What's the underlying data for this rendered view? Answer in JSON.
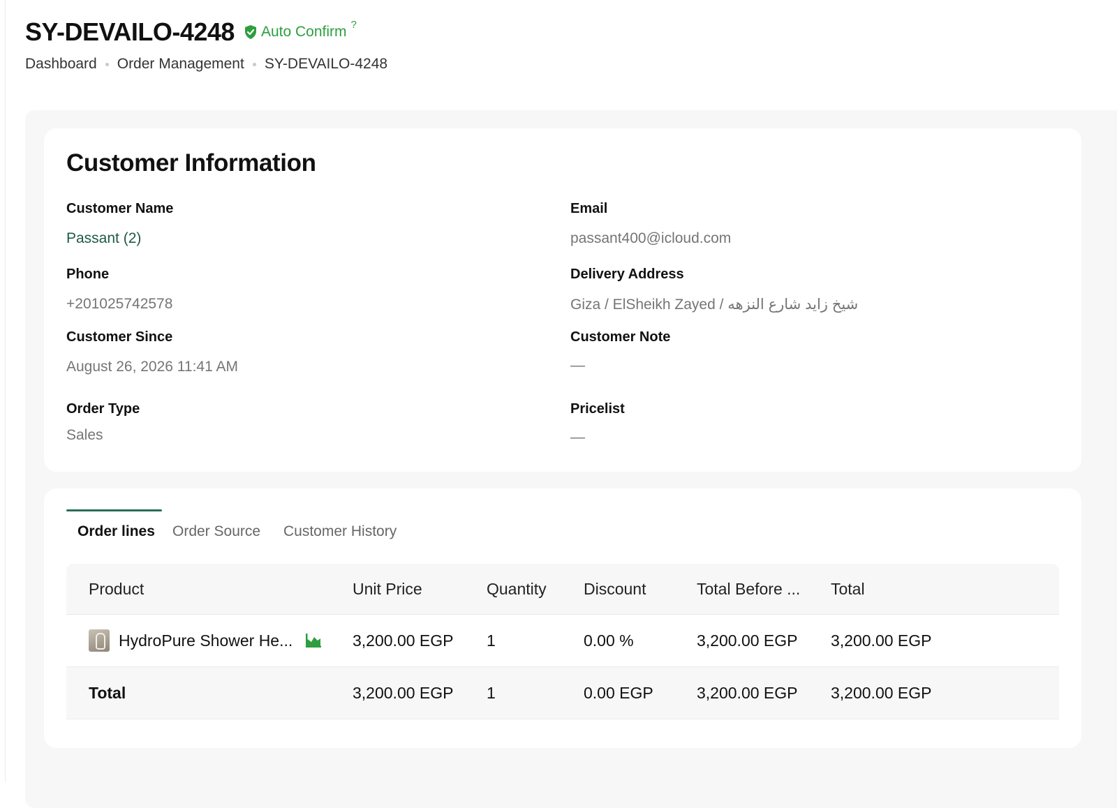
{
  "header": {
    "order_id": "SY-DEVAILO-4248",
    "auto_confirm_label": "Auto Confirm",
    "help_mark": "?",
    "accent_color": "#2e9e3f"
  },
  "breadcrumb": [
    "Dashboard",
    "Order Management",
    "SY-DEVAILO-4248"
  ],
  "customer": {
    "section_title": "Customer Information",
    "fields": {
      "name": {
        "label": "Customer Name",
        "value": "Passant (2)"
      },
      "email": {
        "label": "Email",
        "value": "passant400@icloud.com"
      },
      "phone": {
        "label": "Phone",
        "value": "+201025742578"
      },
      "address": {
        "label": "Delivery Address",
        "value": "Giza / ElSheikh Zayed / شيخ زايد شارع النزهه"
      },
      "since": {
        "label": "Customer Since",
        "value": "August 26, 2026 11:41 AM"
      },
      "note": {
        "label": "Customer Note",
        "value": "—"
      },
      "order_type": {
        "label": "Order Type",
        "value": "Sales"
      },
      "pricelist": {
        "label": "Pricelist",
        "value": "—"
      }
    }
  },
  "tabs": [
    {
      "label": "Order lines",
      "active": true
    },
    {
      "label": "Order Source",
      "active": false
    },
    {
      "label": "Customer History",
      "active": false
    }
  ],
  "order_lines": {
    "columns": [
      "Product",
      "Unit Price",
      "Quantity",
      "Discount",
      "Total Before ...",
      "Total"
    ],
    "rows": [
      {
        "product": "HydroPure Shower He...",
        "product_icon": "product-thumbnail",
        "stats_icon": "chart-icon",
        "unit_price": "3,200.00 EGP",
        "quantity": "1",
        "discount": "0.00 %",
        "total_before": "3,200.00 EGP",
        "total": "3,200.00 EGP"
      }
    ],
    "total_row": {
      "label": "Total",
      "unit_price": "3,200.00 EGP",
      "quantity": "1",
      "discount": "0.00 EGP",
      "total_before": "3,200.00 EGP",
      "total": "3,200.00 EGP"
    }
  }
}
